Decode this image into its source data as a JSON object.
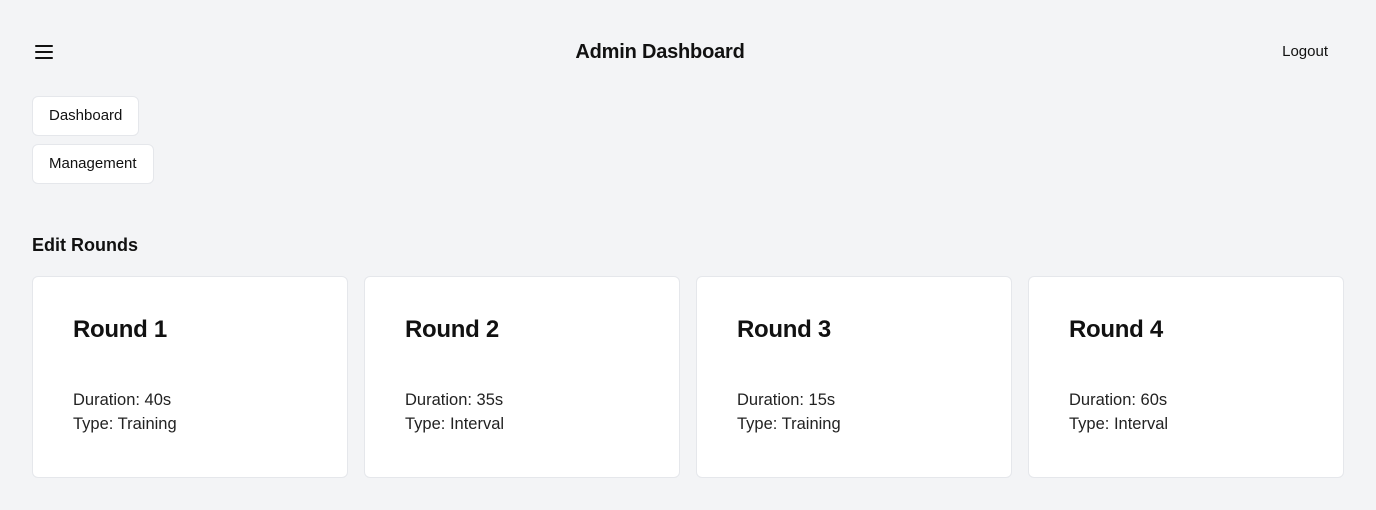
{
  "header": {
    "title": "Admin Dashboard",
    "menu_icon": "hamburger-menu-icon",
    "logout_label": "Logout"
  },
  "nav": {
    "items": [
      {
        "label": "Dashboard"
      },
      {
        "label": "Management"
      }
    ]
  },
  "main": {
    "section_title": "Edit Rounds",
    "rounds": [
      {
        "title": "Round 1",
        "duration": "Duration: 40s",
        "type": "Type: Training"
      },
      {
        "title": "Round 2",
        "duration": "Duration: 35s",
        "type": "Type: Interval"
      },
      {
        "title": "Round 3",
        "duration": "Duration: 15s",
        "type": "Type: Training"
      },
      {
        "title": "Round 4",
        "duration": "Duration: 60s",
        "type": "Type: Interval"
      }
    ]
  },
  "colors": {
    "background": "#f3f4f6",
    "card": "#ffffff",
    "border": "#e5e7eb",
    "text": "#111111"
  }
}
